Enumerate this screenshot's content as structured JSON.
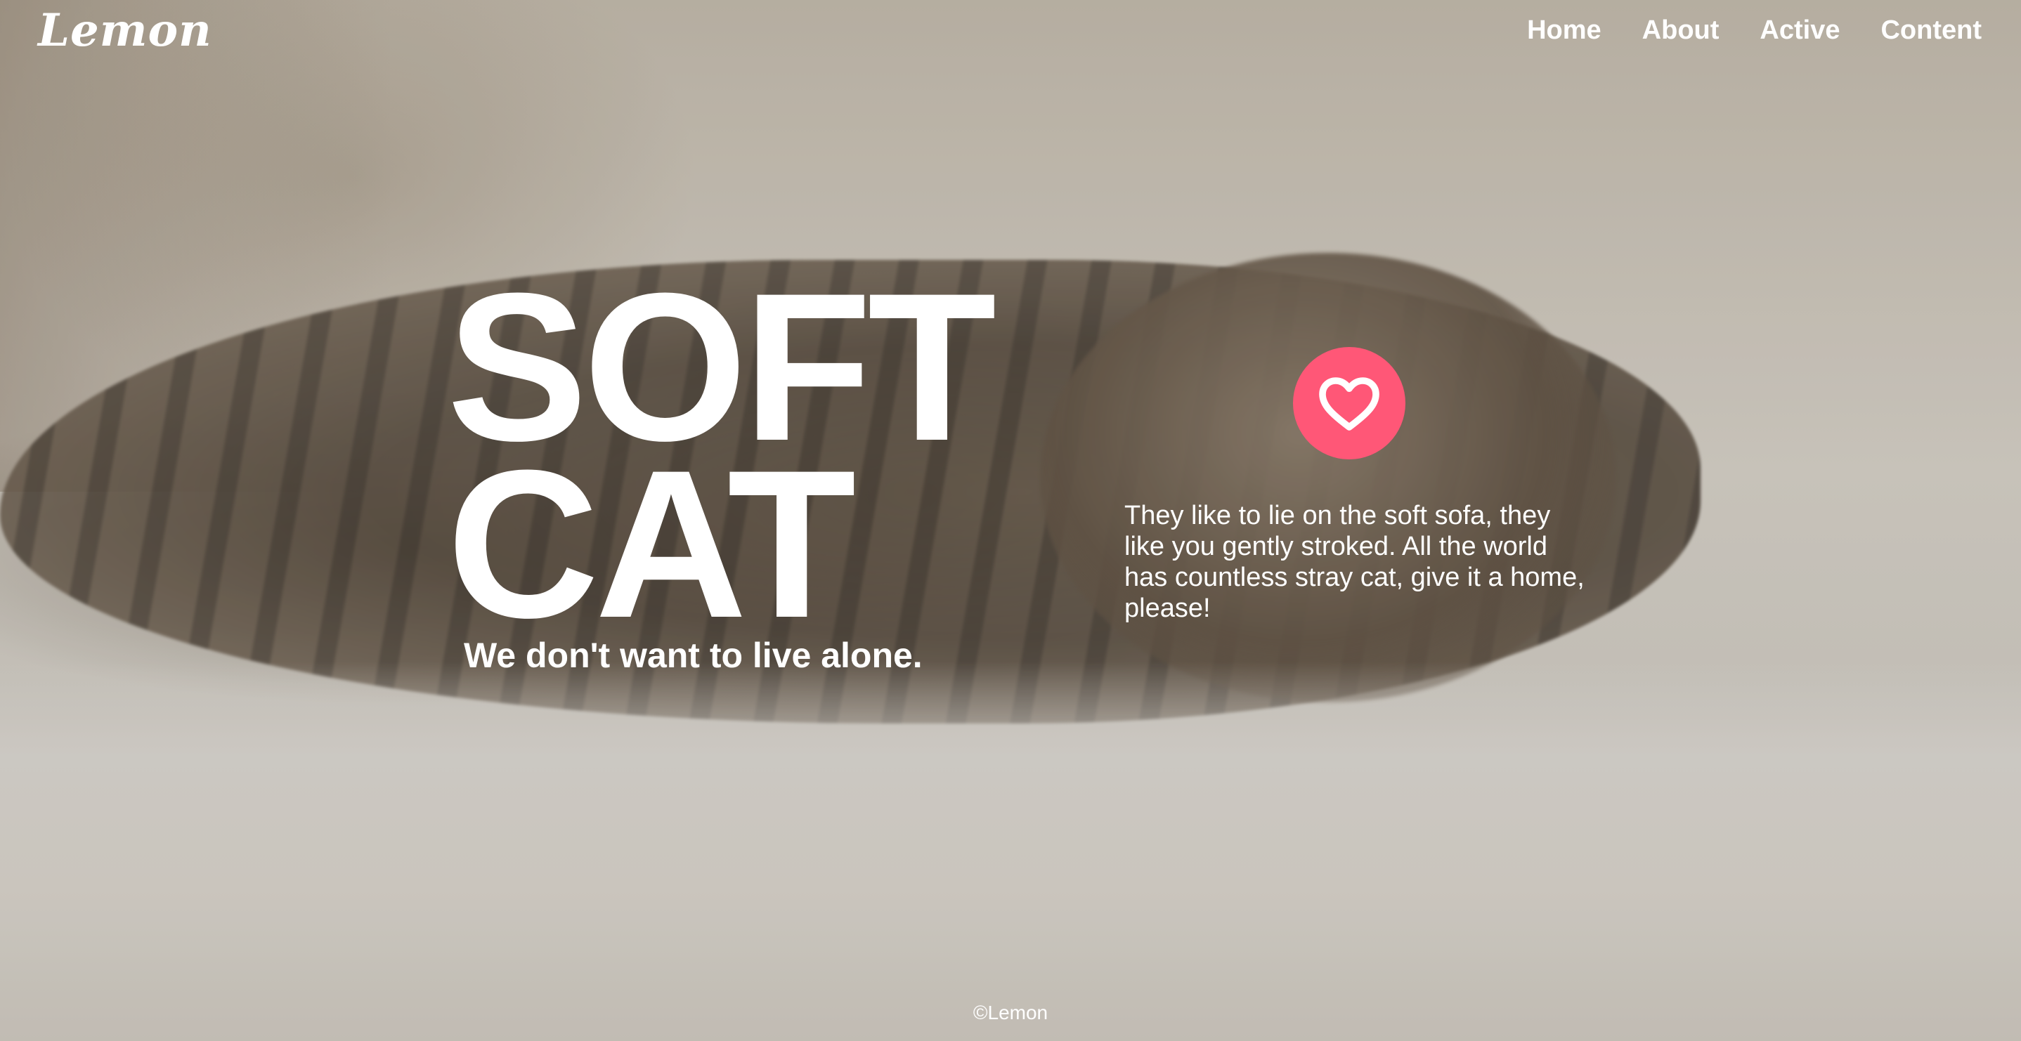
{
  "brand": {
    "logo": "Lemon"
  },
  "nav": {
    "items": [
      {
        "label": "Home"
      },
      {
        "label": "About"
      },
      {
        "label": "Active"
      },
      {
        "label": "Content"
      }
    ]
  },
  "hero": {
    "title_line1": "SOFT",
    "title_line2": "CAT",
    "subtitle": "We don't want to live alone.",
    "description": "They like to lie on the soft sofa, they like you gently stroked. All the world has countless stray cat, give it a home, please!",
    "like_icon": "heart-icon"
  },
  "footer": {
    "copyright": "©Lemon"
  },
  "colors": {
    "accent": "#ff5777",
    "text": "#ffffff"
  }
}
